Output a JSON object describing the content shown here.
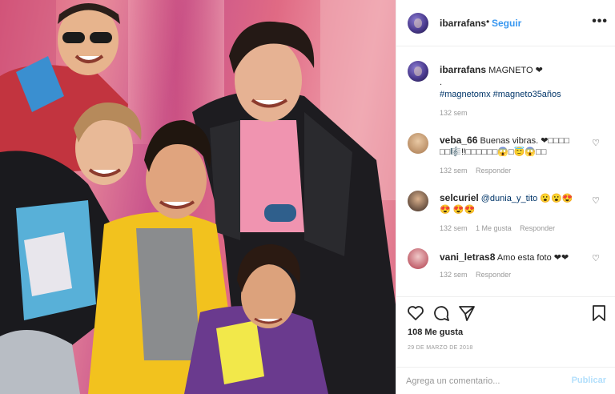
{
  "header": {
    "username": "ibarrafans",
    "separator": "•",
    "follow_label": "Seguir",
    "more_label": "•••"
  },
  "caption": {
    "username": "ibarrafans",
    "text": "MAGNETO ❤",
    "dot_line": ".",
    "hashtags": "#magnetomx #magneto35años",
    "time": "132 sem"
  },
  "comments": [
    {
      "username": "veba_66",
      "text": "Buenas vibras. ❤□□□□ □□🎼‼□□□□□□😱□😇😱□□",
      "mention": "",
      "time": "132 sem",
      "likes": "",
      "reply": "Responder"
    },
    {
      "username": "selcuriel",
      "text": "😮😮😍😍 😍😍",
      "mention": "@dunia_y_tito",
      "time": "132 sem",
      "likes": "1 Me gusta",
      "reply": "Responder"
    },
    {
      "username": "vani_letras8",
      "text": "Amo esta foto ❤❤",
      "mention": "",
      "time": "132 sem",
      "likes": "",
      "reply": "Responder"
    }
  ],
  "actions": {
    "icons": [
      "heart-icon",
      "comment-icon",
      "share-icon",
      "bookmark-icon"
    ],
    "likes": "108 Me gusta",
    "date": "29 DE MARZO DE 2018"
  },
  "comment_box": {
    "placeholder": "Agrega un comentario...",
    "publish_label": "Publicar"
  },
  "colors": {
    "link_blue": "#3897f0",
    "hashtag": "#003569",
    "muted": "#999999",
    "publish_disabled": "#b2dffc",
    "photo_background": "#e06a84"
  }
}
